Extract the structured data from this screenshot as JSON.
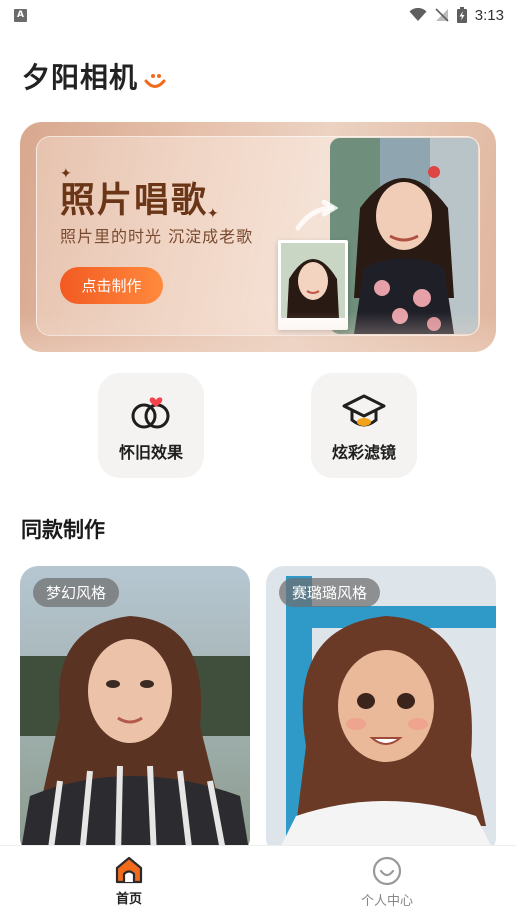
{
  "status_bar": {
    "notification_badge": "A",
    "time": "3:13",
    "icons": [
      "wifi-icon",
      "signal-off-icon",
      "battery-charging-icon"
    ]
  },
  "header": {
    "app_title": "夕阳相机",
    "logo_icon": "smile-logo-icon",
    "accent_color": "#f26b1d"
  },
  "banner": {
    "title": "照片唱歌",
    "subtitle": "照片里的时光 沉淀成老歌",
    "button_label": "点击制作",
    "button_color": "#f25a22"
  },
  "features": [
    {
      "label": "怀旧效果",
      "icon": "linked-circles-heart-icon"
    },
    {
      "label": "炫彩滤镜",
      "icon": "graduation-cap-icon"
    }
  ],
  "section": {
    "title": "同款制作"
  },
  "cards": [
    {
      "tag": "梦幻风格"
    },
    {
      "tag": "赛璐璐风格"
    }
  ],
  "tab_bar": {
    "tabs": [
      {
        "label": "首页",
        "icon": "home-icon",
        "active": true
      },
      {
        "label": "个人中心",
        "icon": "profile-smile-icon",
        "active": false
      }
    ],
    "active_color": "#f26b1d"
  }
}
